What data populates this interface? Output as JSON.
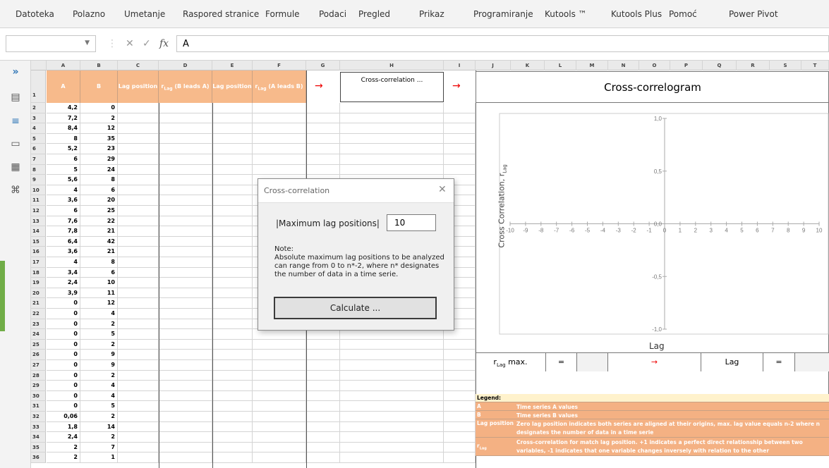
{
  "ribbon": {
    "tabs": [
      "Datoteka",
      "Polazno",
      "Umetanje",
      "Raspored stranice",
      "Formule",
      "Podaci",
      "Pregled",
      "Prikaz",
      "Programiranje",
      "Kutools ™",
      "Kutools Plus",
      "Pomoć",
      "Power Pivot"
    ]
  },
  "formula_bar": {
    "name_box": "",
    "cancel": "✕",
    "enter": "✓",
    "fx": "fx",
    "value": "A"
  },
  "sidebar": {
    "expand": "»",
    "icons": [
      "table-icon",
      "layout-icon",
      "print-icon",
      "grid-icon",
      "binoculars-icon"
    ]
  },
  "columns": [
    "A",
    "B",
    "C",
    "D",
    "E",
    "F",
    "G",
    "H",
    "I",
    "J",
    "K",
    "L",
    "M",
    "N",
    "O",
    "P",
    "Q",
    "R",
    "S",
    "T"
  ],
  "headers": {
    "a": "A",
    "b": "B",
    "c": "Lag position",
    "d_main": "r",
    "d_sub": "Lag",
    "d_rest": " (B leads A)",
    "e": "Lag position",
    "f_main": "r",
    "f_sub": "Lag",
    "f_rest": " (A leads B)",
    "arrow": "→",
    "button": "Cross-correlation ..."
  },
  "rows": [
    {
      "n": "2",
      "a": "4,2",
      "b": "0"
    },
    {
      "n": "3",
      "a": "7,2",
      "b": "2"
    },
    {
      "n": "4",
      "a": "8,4",
      "b": "12"
    },
    {
      "n": "5",
      "a": "8",
      "b": "35"
    },
    {
      "n": "6",
      "a": "5,2",
      "b": "23"
    },
    {
      "n": "7",
      "a": "6",
      "b": "29"
    },
    {
      "n": "8",
      "a": "5",
      "b": "24"
    },
    {
      "n": "9",
      "a": "5,6",
      "b": "8"
    },
    {
      "n": "10",
      "a": "4",
      "b": "6"
    },
    {
      "n": "11",
      "a": "3,6",
      "b": "20"
    },
    {
      "n": "12",
      "a": "6",
      "b": "25"
    },
    {
      "n": "13",
      "a": "7,6",
      "b": "22"
    },
    {
      "n": "14",
      "a": "7,8",
      "b": "21"
    },
    {
      "n": "15",
      "a": "6,4",
      "b": "42"
    },
    {
      "n": "16",
      "a": "3,6",
      "b": "21"
    },
    {
      "n": "17",
      "a": "4",
      "b": "8"
    },
    {
      "n": "18",
      "a": "3,4",
      "b": "6"
    },
    {
      "n": "19",
      "a": "2,4",
      "b": "10"
    },
    {
      "n": "20",
      "a": "3,9",
      "b": "11"
    },
    {
      "n": "21",
      "a": "0",
      "b": "12"
    },
    {
      "n": "22",
      "a": "0",
      "b": "4"
    },
    {
      "n": "23",
      "a": "0",
      "b": "2"
    },
    {
      "n": "24",
      "a": "0",
      "b": "5"
    },
    {
      "n": "25",
      "a": "0",
      "b": "2"
    },
    {
      "n": "26",
      "a": "0",
      "b": "9"
    },
    {
      "n": "27",
      "a": "0",
      "b": "9"
    },
    {
      "n": "28",
      "a": "0",
      "b": "2"
    },
    {
      "n": "29",
      "a": "0",
      "b": "4"
    },
    {
      "n": "30",
      "a": "0",
      "b": "4"
    },
    {
      "n": "31",
      "a": "0",
      "b": "5"
    },
    {
      "n": "32",
      "a": "0,06",
      "b": "2"
    },
    {
      "n": "33",
      "a": "1,8",
      "b": "14"
    },
    {
      "n": "34",
      "a": "2,4",
      "b": "2"
    },
    {
      "n": "35",
      "a": "2",
      "b": "7"
    },
    {
      "n": "36",
      "a": "2",
      "b": "1"
    }
  ],
  "chart": {
    "title": "Cross-correlogram",
    "ylabel_main": "Cross Correlation, r",
    "ylabel_sub": "Lag",
    "xlabel": "Lag",
    "x_ticks": [
      "-10",
      "-9",
      "-8",
      "-7",
      "-6",
      "-5",
      "-4",
      "-3",
      "-2",
      "-1",
      "0",
      "1",
      "2",
      "3",
      "4",
      "5",
      "6",
      "7",
      "8",
      "9",
      "10"
    ],
    "y_ticks": [
      "1,0",
      "0,5",
      "0,0",
      "-0,5",
      "-1,0"
    ]
  },
  "chart_data": {
    "type": "bar",
    "title": "Cross-correlogram",
    "xlabel": "Lag",
    "ylabel": "Cross Correlation, r Lag",
    "xlim": [
      -10,
      10
    ],
    "ylim": [
      -1,
      1
    ],
    "x": [],
    "values": [],
    "grid": false
  },
  "summary": {
    "rmax_main": "r",
    "rmax_sub": "Lag",
    "rmax_rest": " max.",
    "eq1": "=",
    "arrow": "→",
    "lag": "Lag",
    "eq2": "="
  },
  "legend": {
    "title": "Legend:",
    "items": [
      {
        "key": "A",
        "text": "Time series A values"
      },
      {
        "key": "B",
        "text": "Time series B values"
      },
      {
        "key": "Lag position",
        "text": "Zero lag position indicates both series are aligned at their origins, max. lag value equals n-2 where n designates the number of data in a time serie"
      },
      {
        "key_main": "r",
        "key_sub": "Lag",
        "text": "Cross-correlation for match lag position. +1 indicates a perfect direct relationship between two variables, -1 indicates that one variable changes inversely with relation to the other"
      }
    ]
  },
  "dialog": {
    "title": "Cross-correlation",
    "close": "✕",
    "label": "|Maximum lag positions|",
    "value": "10",
    "note": "Note:\nAbsolute maximum lag positions to be analyzed can range from 0 to n*-2, where n* designates the number of data in a time serie.",
    "button": "Calculate ..."
  },
  "colors": {
    "header_orange": "#f7ba8b",
    "legend_yellow": "#fff2cc",
    "legend_orange": "#f4b183",
    "arrow_red": "#ee0000"
  }
}
